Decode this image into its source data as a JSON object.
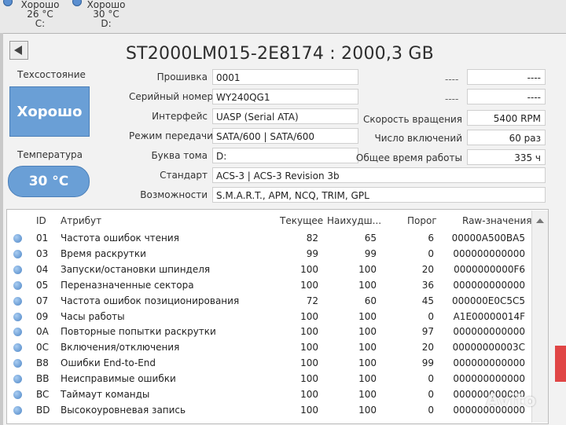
{
  "drives": [
    {
      "status": "Хорошо",
      "temp": "26 °C",
      "letter": "C:"
    },
    {
      "status": "Хорошо",
      "temp": "30 °C",
      "letter": "D:"
    }
  ],
  "title": "ST2000LM015-2E8174 : 2000,3 GB",
  "health_label": "Техсостояние",
  "health_value": "Хорошо",
  "temp_label": "Температура",
  "temp_value": "30 °C",
  "info": {
    "firmware": {
      "label": "Прошивка",
      "value": "0001"
    },
    "serial": {
      "label": "Серийный номер",
      "value": "WY240QG1"
    },
    "interface": {
      "label": "Интерфейс",
      "value": "UASP (Serial ATA)"
    },
    "mode": {
      "label": "Режим передачи",
      "value": "SATA/600 | SATA/600"
    },
    "volume": {
      "label": "Буква тома",
      "value": "D:"
    },
    "standard": {
      "label": "Стандарт",
      "value": "ACS-3 | ACS-3 Revision 3b"
    },
    "features": {
      "label": "Возможности",
      "value": "S.M.A.R.T., APM, NCQ, TRIM, GPL"
    }
  },
  "right": {
    "r1_left": "----",
    "r1_right": "----",
    "r2_left": "----",
    "r2_right": "----",
    "rotation": {
      "label": "Скорость вращения",
      "value": "5400 RPM"
    },
    "power_count": {
      "label": "Число включений",
      "value": "60 раз"
    },
    "power_time": {
      "label": "Общее время работы",
      "value": "335 ч"
    }
  },
  "table": {
    "headers": {
      "id": "ID",
      "attr": "Атрибут",
      "cur": "Текущее",
      "worst": "Наихудш...",
      "thr": "Порог",
      "raw": "Raw-значения"
    },
    "rows": [
      {
        "id": "01",
        "name": "Частота ошибок чтения",
        "cur": "82",
        "worst": "65",
        "thr": "6",
        "raw": "00000A500BA5"
      },
      {
        "id": "03",
        "name": "Время раскрутки",
        "cur": "99",
        "worst": "99",
        "thr": "0",
        "raw": "000000000000"
      },
      {
        "id": "04",
        "name": "Запуски/остановки шпинделя",
        "cur": "100",
        "worst": "100",
        "thr": "20",
        "raw": "0000000000F6"
      },
      {
        "id": "05",
        "name": "Переназначенные сектора",
        "cur": "100",
        "worst": "100",
        "thr": "36",
        "raw": "000000000000"
      },
      {
        "id": "07",
        "name": "Частота ошибок позиционирования",
        "cur": "72",
        "worst": "60",
        "thr": "45",
        "raw": "000000E0C5C5"
      },
      {
        "id": "09",
        "name": "Часы работы",
        "cur": "100",
        "worst": "100",
        "thr": "0",
        "raw": "A1E00000014F"
      },
      {
        "id": "0A",
        "name": "Повторные попытки раскрутки",
        "cur": "100",
        "worst": "100",
        "thr": "97",
        "raw": "000000000000"
      },
      {
        "id": "0C",
        "name": "Включения/отключения",
        "cur": "100",
        "worst": "100",
        "thr": "20",
        "raw": "00000000003C"
      },
      {
        "id": "B8",
        "name": "Ошибки End-to-End",
        "cur": "100",
        "worst": "100",
        "thr": "99",
        "raw": "000000000000"
      },
      {
        "id": "BB",
        "name": "Неисправимые ошибки",
        "cur": "100",
        "worst": "100",
        "thr": "0",
        "raw": "000000000000"
      },
      {
        "id": "BC",
        "name": "Таймаут команды",
        "cur": "100",
        "worst": "100",
        "thr": "0",
        "raw": "000000000000"
      },
      {
        "id": "BD",
        "name": "Высокоуровневая запись",
        "cur": "100",
        "worst": "100",
        "thr": "0",
        "raw": "000000000000"
      }
    ]
  },
  "watermark": "Avito"
}
